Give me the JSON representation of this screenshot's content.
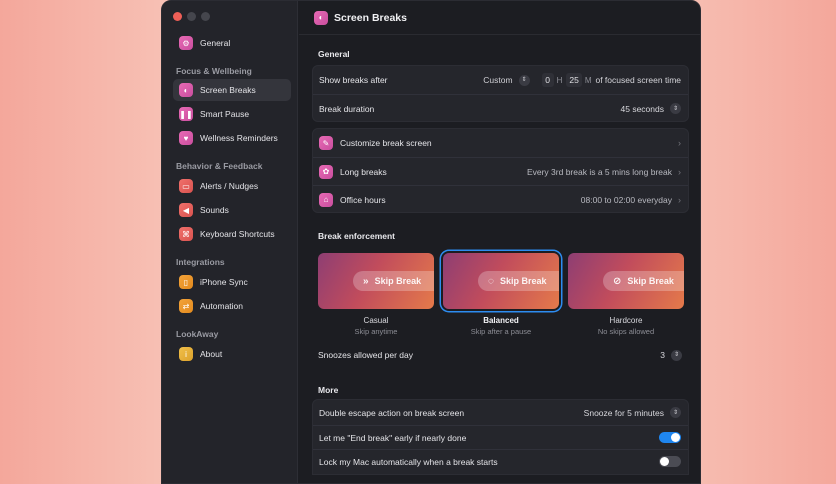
{
  "sidebar": {
    "general": "General",
    "sections": {
      "focus": "Focus & Wellbeing",
      "behavior": "Behavior & Feedback",
      "integrations": "Integrations",
      "lookaway": "LookAway"
    },
    "items": {
      "screen_breaks": "Screen Breaks",
      "smart_pause": "Smart Pause",
      "wellness": "Wellness Reminders",
      "alerts": "Alerts / Nudges",
      "sounds": "Sounds",
      "shortcuts": "Keyboard Shortcuts",
      "iphone": "iPhone Sync",
      "automation": "Automation",
      "about": "About"
    }
  },
  "header": {
    "title": "Screen Breaks"
  },
  "general": {
    "heading": "General",
    "show_breaks_label": "Show breaks after",
    "mode": "Custom",
    "hours": "0",
    "hours_unit": "H",
    "minutes": "25",
    "minutes_unit": "M",
    "suffix": "of focused screen time",
    "duration_label": "Break duration",
    "duration_value": "45 seconds"
  },
  "links": {
    "customize": "Customize break screen",
    "long_breaks": "Long breaks",
    "long_breaks_value": "Every 3rd break is a 5 mins long break",
    "office_hours": "Office hours",
    "office_hours_value": "08:00 to 02:00 everyday"
  },
  "enforcement": {
    "heading": "Break enforcement",
    "skip_label": "Skip Break",
    "options": [
      {
        "title": "Casual",
        "subtitle": "Skip anytime"
      },
      {
        "title": "Balanced",
        "subtitle": "Skip after a pause"
      },
      {
        "title": "Hardcore",
        "subtitle": "No skips allowed"
      }
    ],
    "snoozes_label": "Snoozes allowed per day",
    "snoozes_value": "3"
  },
  "more": {
    "heading": "More",
    "double_escape_label": "Double escape action on break screen",
    "double_escape_value": "Snooze for 5 minutes",
    "end_early_label": "Let me \"End break\" early if nearly done",
    "lock_mac_label": "Lock my Mac automatically when a break starts"
  }
}
